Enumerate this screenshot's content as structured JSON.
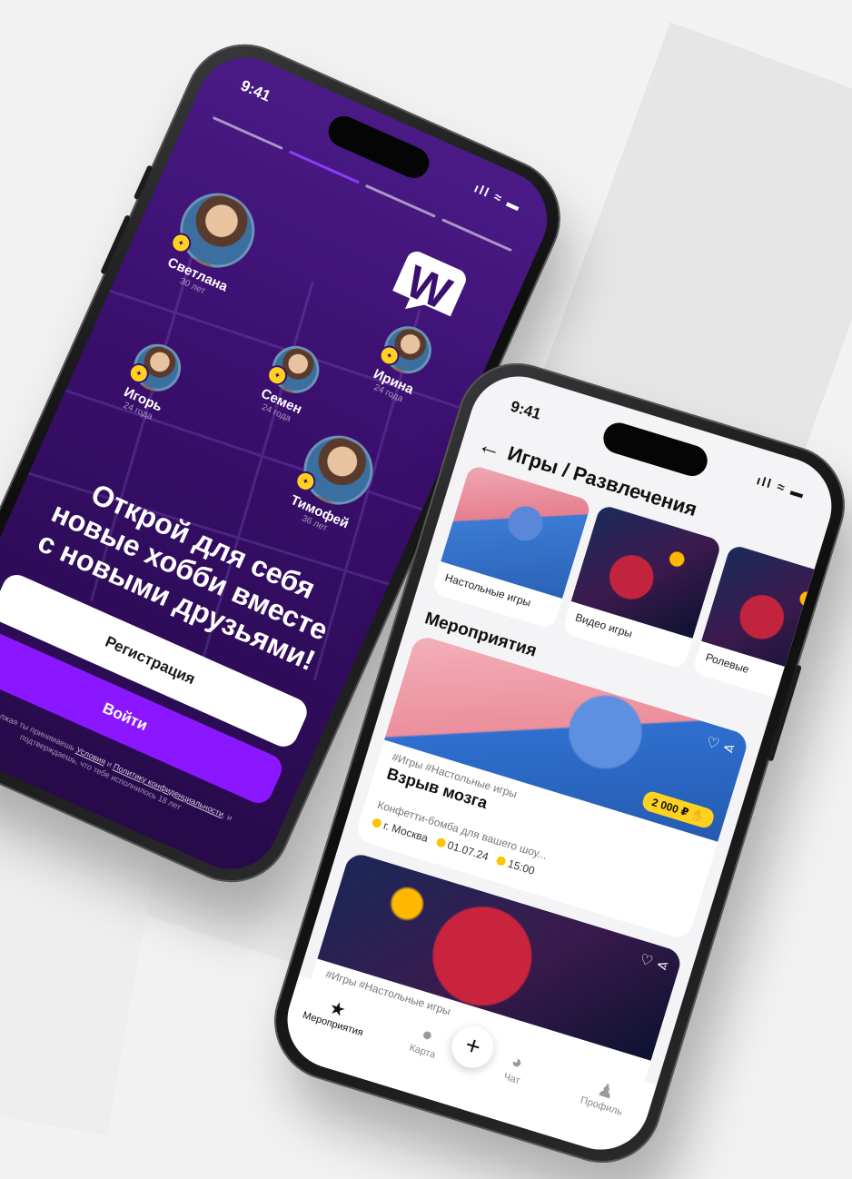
{
  "phone1": {
    "status_time": "9:41",
    "status_icons": "ıll ≈ ▬",
    "logo": "W",
    "people": [
      {
        "name": "Светлана",
        "age": "30 лет"
      },
      {
        "name": "Семен",
        "age": "24 года"
      },
      {
        "name": "Ирина",
        "age": "24 года"
      },
      {
        "name": "Игорь",
        "age": "24 года"
      },
      {
        "name": "Тимофей",
        "age": "36 лет"
      }
    ],
    "headline_1": "Открой для себя",
    "headline_2": "новые хобби вместе",
    "headline_3": "с новыми друзьями!",
    "register_label": "Регистрация",
    "login_label": "Войти",
    "legal_1": "Продолжая ты принимаешь",
    "legal_link_1": "Условия",
    "legal_2": "и",
    "legal_link_2": "Политику конфиденциальности",
    "legal_3": ", и подтверждаешь, что тебе исполнилось 18 лет"
  },
  "phone2": {
    "status_time": "9:41",
    "status_icons": "ıll ≈ ▬",
    "title": "Игры / Развлечения",
    "categories": [
      {
        "label": "Настольные игры"
      },
      {
        "label": "Видео игры"
      },
      {
        "label": "Ролевые"
      }
    ],
    "section_title": "Мероприятия",
    "event1": {
      "tags": "#Игры  #Настольные игры",
      "name": "Взрыв мозга",
      "desc": "Конфетти-бомба для вашего шоу...",
      "city": "г. Москва",
      "date": "01.07.24",
      "time": "15:00",
      "price": "2 000 ₽"
    },
    "event2": {
      "tags": "#Игры  #Настольные игры"
    },
    "fab": "+",
    "tabs": [
      {
        "label": "Мероприятия"
      },
      {
        "label": "Карта"
      },
      {
        "label": "Чат"
      },
      {
        "label": "Профиль"
      }
    ]
  },
  "colors": {
    "brand_purple": "#8a17ff",
    "dark_purple": "#3a0f6e",
    "accent_yellow": "#ffd21f"
  }
}
